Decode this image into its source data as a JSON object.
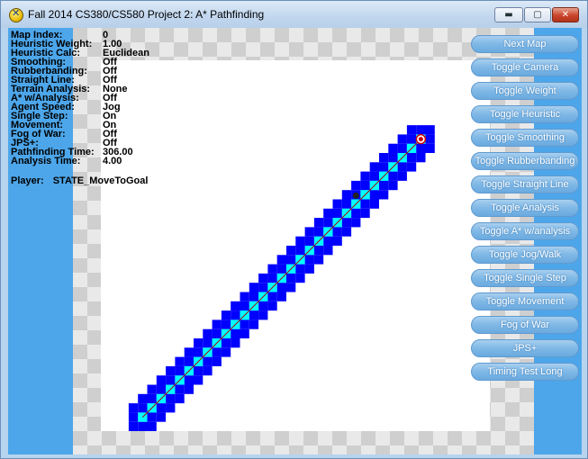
{
  "window": {
    "title": "Fall 2014 CS380/CS580 Project 2: A* Pathfinding"
  },
  "controls": {
    "minimize": "▬",
    "maximize": "▢",
    "close": "✕"
  },
  "info": [
    {
      "label": "Map Index:",
      "value": "0"
    },
    {
      "label": "Heuristic Weight:",
      "value": "1.00"
    },
    {
      "label": "Heuristic Calc:",
      "value": "Euclidean"
    },
    {
      "label": "Smoothing:",
      "value": "Off"
    },
    {
      "label": "Rubberbanding:",
      "value": "Off"
    },
    {
      "label": "Straight Line:",
      "value": "Off"
    },
    {
      "label": "Terrain Analysis:",
      "value": "None"
    },
    {
      "label": "A* w/Analysis:",
      "value": "Off"
    },
    {
      "label": "Agent Speed:",
      "value": "Jog"
    },
    {
      "label": "Single Step:",
      "value": "On"
    },
    {
      "label": "Movement:",
      "value": "On"
    },
    {
      "label": "Fog of War:",
      "value": "Off"
    },
    {
      "label": "JPS+:",
      "value": "Off"
    },
    {
      "label": "Pathfinding Time:",
      "value": "306.00"
    },
    {
      "label": "Analysis Time:",
      "value": "4.00"
    }
  ],
  "player": {
    "label": "Player:",
    "state": "STATE_MoveToGoal"
  },
  "buttons": [
    "Next Map",
    "Toggle Camera",
    "Toggle Weight",
    "Toggle Heuristic",
    "Toggle Smoothing",
    "Toggle Rubberbanding",
    "Toggle Straight Line",
    "Toggle Analysis",
    "Toggle A* w/analysis",
    "Toggle Jog/Walk",
    "Toggle Single Step",
    "Toggle Movement",
    "Fog of War",
    "JPS+",
    "Timing Test Long"
  ],
  "map": {
    "colors": {
      "open_list": "#0000ff",
      "path": "#00ffff",
      "line": "#b00000",
      "goal": "#cc0000"
    },
    "icons": [
      "agent-icon",
      "goal-target-icon"
    ]
  }
}
